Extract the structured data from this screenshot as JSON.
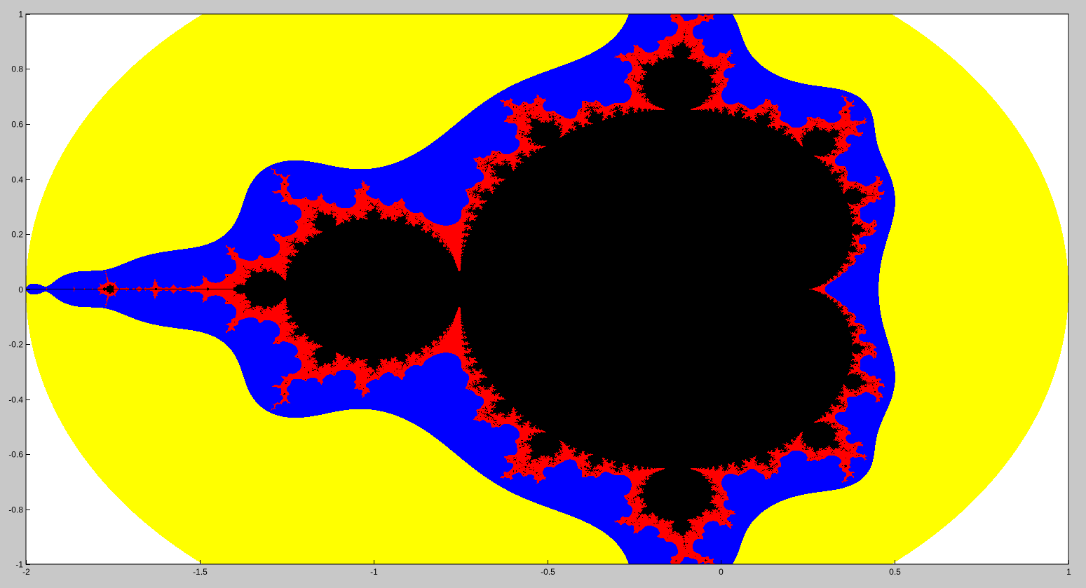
{
  "figure": {
    "background": "#c8c8c8",
    "plot_background": "#ffffff",
    "axes_color": "#000000"
  },
  "chart_data": {
    "type": "heatmap",
    "title": "",
    "xlabel": "",
    "ylabel": "",
    "xlim": [
      -2,
      1
    ],
    "ylim": [
      -1,
      1
    ],
    "grid": false,
    "x_ticks": [
      -2,
      -1.5,
      -1,
      -0.5,
      0,
      0.5,
      1
    ],
    "x_tick_labels": [
      "-2",
      "-1.5",
      "-1",
      "-0.5",
      "0",
      "0.5",
      "1"
    ],
    "y_ticks": [
      -1,
      -0.8,
      -0.6,
      -0.4,
      -0.2,
      0,
      0.2,
      0.4,
      0.6,
      0.8,
      1
    ],
    "y_tick_labels": [
      "-1",
      "-0.8",
      "-0.6",
      "-0.4",
      "-0.2",
      "0",
      "0.2",
      "0.4",
      "0.6",
      "0.8",
      "1"
    ],
    "colormap": [
      {
        "band": "exterior",
        "color": "#ffffff"
      },
      {
        "band": "near",
        "color": "#ffff00"
      },
      {
        "band": "closer",
        "color": "#0000ff"
      },
      {
        "band": "boundary",
        "color": "#ff0000"
      },
      {
        "band": "set",
        "color": "#000000"
      }
    ]
  }
}
